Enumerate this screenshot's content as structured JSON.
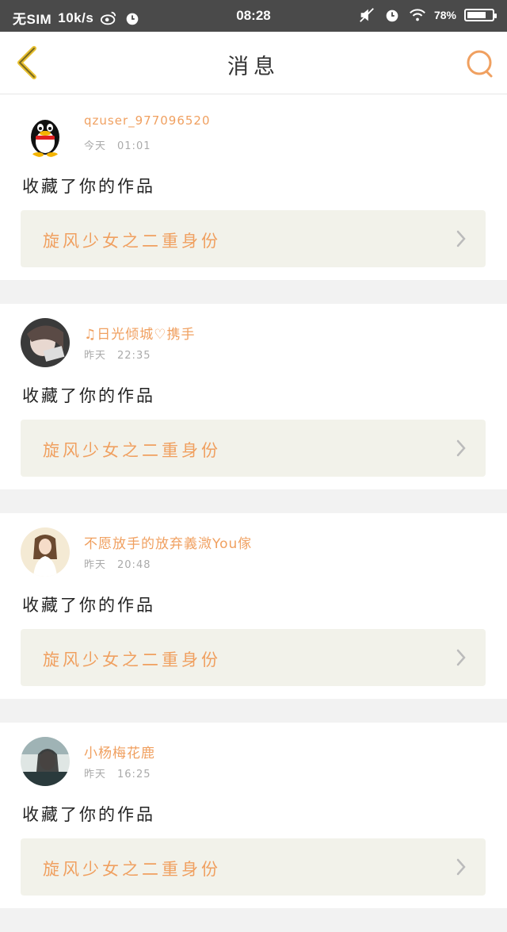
{
  "status_bar": {
    "carrier": "无SIM",
    "speed": "10k/s",
    "time": "08:28",
    "battery": "78",
    "battery_level": 0.78
  },
  "header": {
    "title": "消息",
    "back_icon": "chevron-left-icon",
    "search_icon": "search-icon"
  },
  "colors": {
    "accent": "#f0a060",
    "back_arrow": "#e8c030",
    "work_bg": "#f2f2ea"
  },
  "messages": [
    {
      "username": "qzuser_977096520",
      "day": "今天",
      "time": "01:01",
      "action": "收藏了你的作品",
      "work_title": "旋风少女之二重身份"
    },
    {
      "username": "♫日光倾城♡携手",
      "day": "昨天",
      "time": "22:35",
      "action": "收藏了你的作品",
      "work_title": "旋风少女之二重身份"
    },
    {
      "username": "不愿放手的放弃義溦You傢",
      "day": "昨天",
      "time": "20:48",
      "action": "收藏了你的作品",
      "work_title": "旋风少女之二重身份"
    },
    {
      "username": "小杨梅花鹿",
      "day": "昨天",
      "time": "16:25",
      "action": "收藏了你的作品",
      "work_title": "旋风少女之二重身份"
    }
  ]
}
